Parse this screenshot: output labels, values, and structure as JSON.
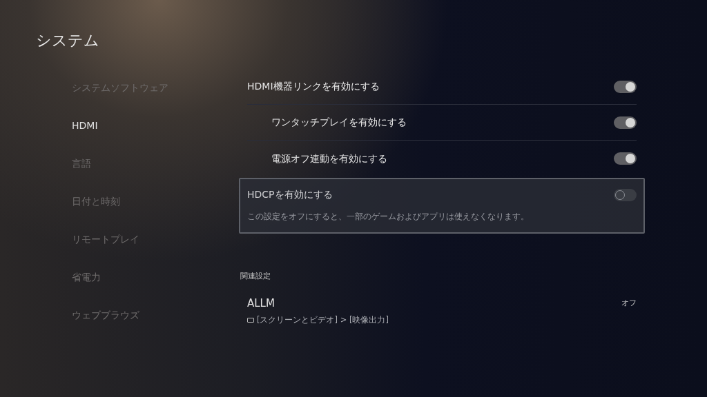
{
  "title": "システム",
  "sidebar": {
    "items": [
      {
        "label": "システムソフトウェア",
        "selected": false
      },
      {
        "label": "HDMI",
        "selected": true
      },
      {
        "label": "言語",
        "selected": false
      },
      {
        "label": "日付と時刻",
        "selected": false
      },
      {
        "label": "リモートプレイ",
        "selected": false
      },
      {
        "label": "省電力",
        "selected": false
      },
      {
        "label": "ウェブブラウズ",
        "selected": false
      }
    ]
  },
  "settings": [
    {
      "label": "HDMI機器リンクを有効にする",
      "indented": false,
      "on": true,
      "selected": false
    },
    {
      "label": "ワンタッチプレイを有効にする",
      "indented": true,
      "on": true,
      "selected": false
    },
    {
      "label": "電源オフ連動を有効にする",
      "indented": true,
      "on": true,
      "selected": false
    },
    {
      "label": "HDCPを有効にする",
      "indented": false,
      "on": false,
      "selected": true,
      "description": "この設定をオフにすると、一部のゲームおよびアプリは使えなくなります。"
    }
  ],
  "related": {
    "heading": "関連設定",
    "items": [
      {
        "label": "ALLM",
        "value": "オフ",
        "path": "[スクリーンとビデオ] > [映像出力]"
      }
    ]
  }
}
